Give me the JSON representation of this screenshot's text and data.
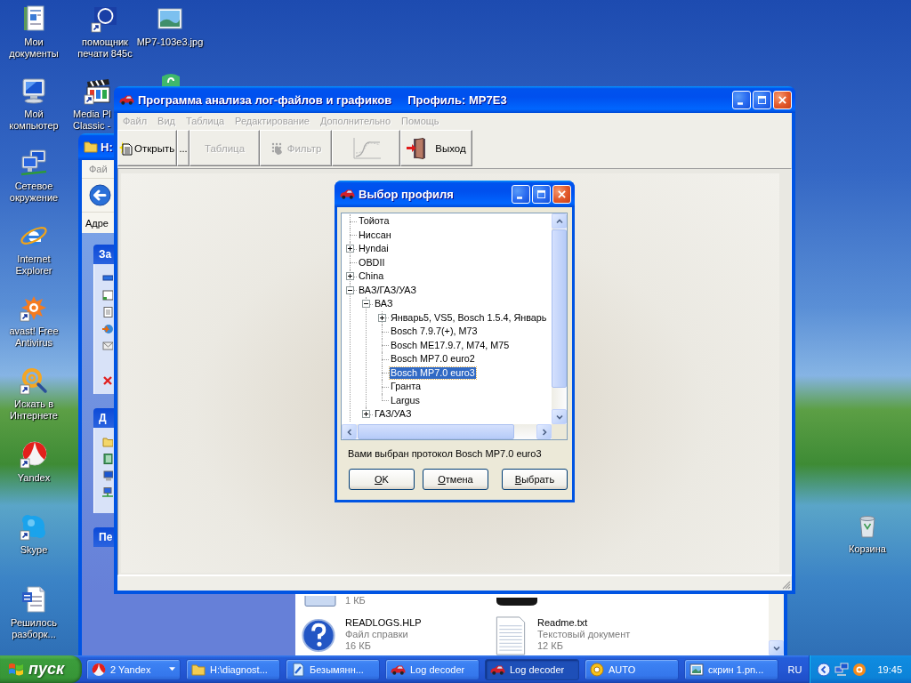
{
  "desktop": {
    "icons": [
      {
        "kind": "documents",
        "label": "Мои документы"
      },
      {
        "kind": "computer",
        "label": "Мой компьютер"
      },
      {
        "kind": "network",
        "label": "Сетевое окружение"
      },
      {
        "kind": "browser",
        "label": "Internet Explorer"
      },
      {
        "kind": "antivirus",
        "label": "avast! Free Antivirus"
      },
      {
        "kind": "search",
        "label": "Искать в Интернете"
      },
      {
        "kind": "yandex",
        "label": "Yandex"
      },
      {
        "kind": "skype",
        "label": "Skype"
      },
      {
        "kind": "word",
        "label": "Решилось разборк..."
      },
      {
        "kind": "printer",
        "label": "помощник печати 845c"
      },
      {
        "kind": "media",
        "label": "Media Pl Classic -"
      },
      {
        "kind": "image",
        "label": "MP7-103e3.jpg"
      },
      {
        "kind": "shield"
      },
      {
        "kind": "trash",
        "label": "Корзина"
      }
    ]
  },
  "explorer_window": {
    "title": "H:",
    "menu": [
      "Фай"
    ],
    "address_label": "Адре",
    "task_panels": [
      {
        "title": "За"
      },
      {
        "title": "Д"
      },
      {
        "title": "Пе"
      }
    ],
    "files": [
      {
        "kind": "blank",
        "size": "1 КБ"
      },
      {
        "kind": "device"
      },
      {
        "kind": "help",
        "name": "READLOGS.HLP",
        "type": "Файл справки",
        "size": "16 КБ"
      },
      {
        "kind": "text",
        "name": "Readme.txt",
        "type": "Текстовый документ",
        "size": "12 КБ"
      }
    ]
  },
  "main_window": {
    "title": "Программа анализа лог-файлов и графиков",
    "profile": "Профиль: MP7E3",
    "menu": [
      {
        "label": "Файл",
        "disabled": true
      },
      {
        "label": "Вид",
        "disabled": true
      },
      {
        "label": "Таблица",
        "disabled": true
      },
      {
        "label": "Редактирование",
        "disabled": true
      },
      {
        "label": "Дополнительно",
        "disabled": true
      },
      {
        "label": "Помощь",
        "disabled": true
      }
    ],
    "toolbar": [
      {
        "kind": "open",
        "label": "Открыть",
        "disabled": false
      },
      {
        "kind": "more",
        "label": "...",
        "disabled": false
      },
      {
        "kind": "table",
        "label": "Таблица",
        "disabled": true
      },
      {
        "kind": "filter",
        "label": "Фильтр",
        "disabled": true
      },
      {
        "kind": "chart",
        "disabled": true
      },
      {
        "kind": "exit",
        "label": "Выход",
        "disabled": false
      }
    ]
  },
  "dialog": {
    "title": "Выбор профиля",
    "tree": [
      {
        "label": "Тойота",
        "kind": "leaf",
        "expanded": false,
        "selected": false
      },
      {
        "label": "Ниссан",
        "kind": "leaf",
        "expanded": false,
        "selected": false
      },
      {
        "label": "Hyndai",
        "kind": "node",
        "expanded": false,
        "selected": false
      },
      {
        "label": "OBDII",
        "kind": "leaf",
        "expanded": false,
        "selected": false
      },
      {
        "label": "China",
        "kind": "node",
        "expanded": false,
        "selected": false
      },
      {
        "label": "ВАЗ/ГАЗ/УАЗ",
        "kind": "node",
        "expanded": true,
        "selected": false,
        "children": [
          {
            "label": "ВАЗ",
            "kind": "node",
            "expanded": true,
            "selected": false,
            "children": [
              {
                "label": "Январь5, VS5, Bosch 1.5.4, Январь",
                "kind": "node",
                "expanded": false,
                "selected": false
              },
              {
                "label": "Bosch 7.9.7(+), M73",
                "kind": "leaf",
                "expanded": false,
                "selected": false
              },
              {
                "label": "Bosch ME17.9.7, M74, M75",
                "kind": "leaf",
                "expanded": false,
                "selected": false
              },
              {
                "label": "Bosch MP7.0 euro2",
                "kind": "leaf",
                "expanded": false,
                "selected": false
              },
              {
                "label": "Bosch MP7.0 euro3",
                "kind": "leaf",
                "expanded": false,
                "selected": true
              },
              {
                "label": "Гранта",
                "kind": "leaf",
                "expanded": false,
                "selected": false
              },
              {
                "label": "Largus",
                "kind": "leaf",
                "expanded": false,
                "selected": false
              }
            ]
          },
          {
            "label": "ГАЗ/УАЗ",
            "kind": "node",
            "expanded": false,
            "selected": false
          }
        ]
      }
    ],
    "status": "Вами выбран протокол Bosch MP7.0 euro3",
    "buttons": [
      {
        "label": "OK"
      },
      {
        "label": "Отмена"
      },
      {
        "label": "Выбрать"
      }
    ]
  },
  "taskbar": {
    "start": "пуск",
    "tasks": [
      {
        "kind": "yandex",
        "label": "2 Yandex",
        "grouped": true,
        "selected": false
      },
      {
        "kind": "folder",
        "label": "H:\\diagnost...",
        "grouped": false,
        "selected": false
      },
      {
        "kind": "paint",
        "label": "Безымянн...",
        "grouped": false,
        "selected": false
      },
      {
        "kind": "car",
        "label": "Log decoder",
        "grouped": false,
        "selected": false
      },
      {
        "kind": "car",
        "label": "Log decoder",
        "grouped": false,
        "selected": true
      },
      {
        "kind": "disc",
        "label": "AUTO",
        "grouped": false,
        "selected": false
      },
      {
        "kind": "image",
        "label": "скрин 1.pn...",
        "grouped": false,
        "selected": false
      }
    ],
    "language": "RU",
    "clock": "19:45"
  }
}
